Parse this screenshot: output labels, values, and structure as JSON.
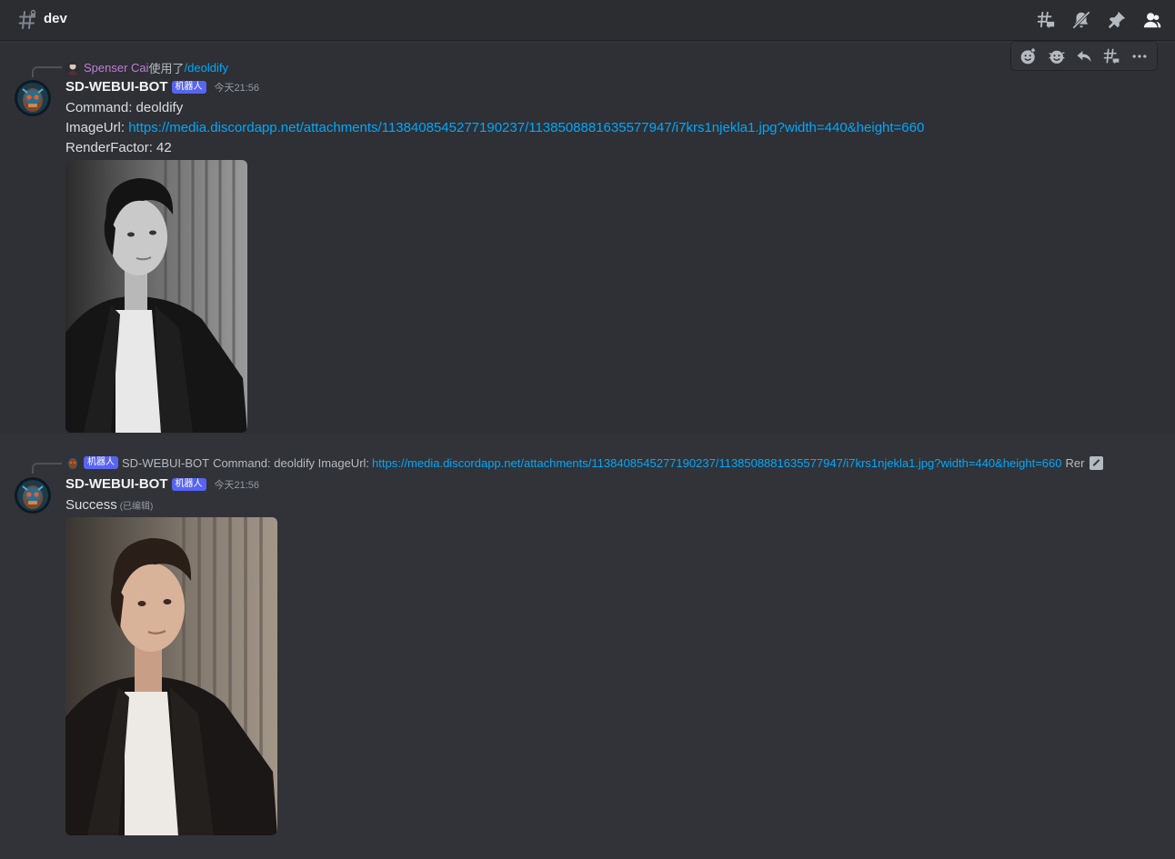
{
  "channel": {
    "name": "dev"
  },
  "header_icons": [
    "threads-icon",
    "bell-muted-icon",
    "pin-icon",
    "members-icon"
  ],
  "hover_toolbar_icons": [
    "add-reaction-icon",
    "super-reaction-icon",
    "reply-icon",
    "create-thread-icon",
    "more-icon"
  ],
  "messages": [
    {
      "reply": {
        "user": "Spenser Cai",
        "used_text": "使用了",
        "command": "/deoldify"
      },
      "author": "SD-WEBUI-BOT",
      "bot_tag": "机器人",
      "timestamp": "今天21:56",
      "lines": {
        "command": "Command: deoldify",
        "imageurl_label": "ImageUrl: ",
        "imageurl_link": "https://media.discordapp.net/attachments/1138408545277190237/1138508881635577947/i7krs1njekla1.jpg?width=440&height=660",
        "render_factor": "RenderFactor: 42"
      },
      "attachment": {
        "type": "grayscale-portrait"
      }
    },
    {
      "reply": {
        "bot_tag": "机器人",
        "user": "SD-WEBUI-BOT",
        "preview_text": "Command: deoldify ImageUrl:",
        "preview_link": "https://media.discordapp.net/attachments/1138408545277190237/1138508881635577947/i7krs1njekla1.jpg?width=440&height=660",
        "preview_tail": "Rer"
      },
      "author": "SD-WEBUI-BOT",
      "bot_tag": "机器人",
      "timestamp": "今天21:56",
      "lines": {
        "content": "Success",
        "edited": "(已编辑)"
      },
      "attachment": {
        "type": "colorized-portrait"
      }
    }
  ],
  "colors": {
    "background": "#313338",
    "header": "#2b2d31",
    "link": "#00a8fc",
    "bot_tag": "#5865f2",
    "reply_user": "#c27cd8"
  }
}
